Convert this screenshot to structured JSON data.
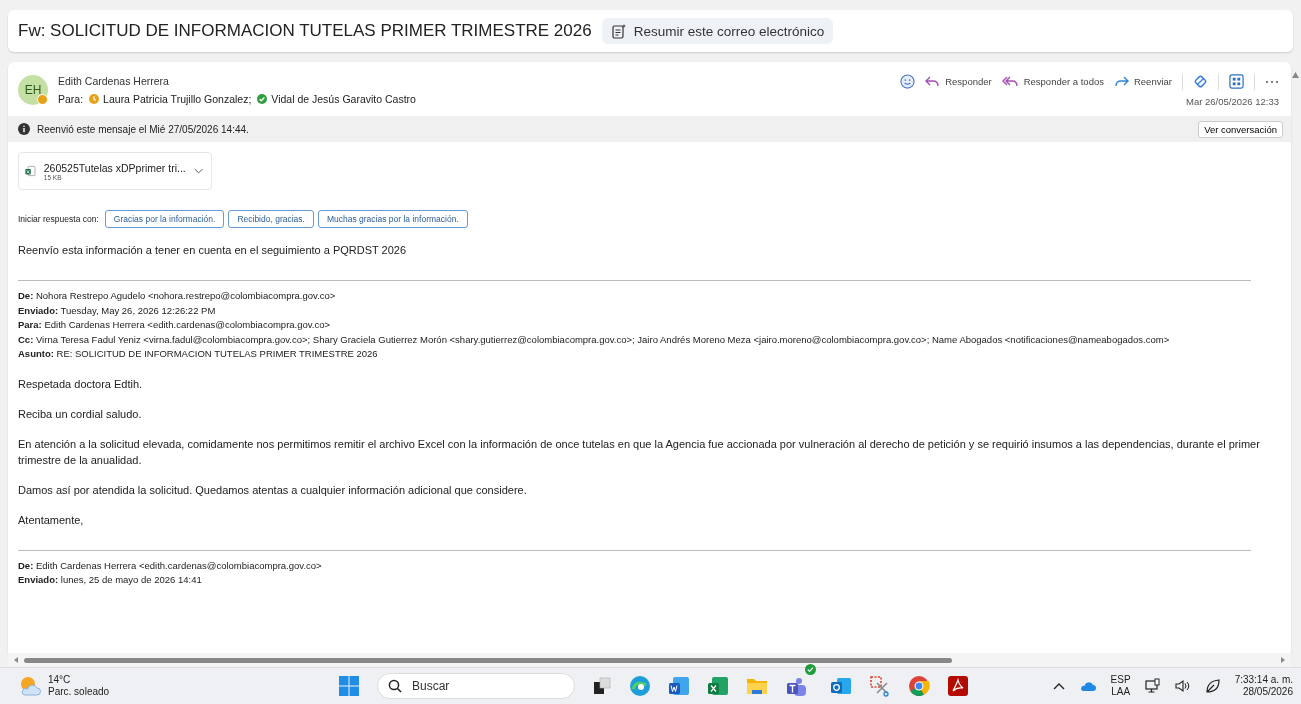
{
  "email_title": "Fw: SOLICITUD DE INFORMACION TUTELAS PRIMER TRIMESTRE 2026",
  "summarize_button": "Resumir este correo electrónico",
  "message": {
    "sender": {
      "initials": "EH",
      "name": "Edith Cardenas Herrera",
      "available": false
    },
    "to_label": "Para:",
    "recipients": [
      {
        "name": "Laura Patricia Trujillo Gonzalez;",
        "available": false
      },
      {
        "name": "Vidal de Jesús Garavito Castro",
        "available": true
      }
    ],
    "actions": [
      {
        "label": "Responder",
        "kind": "reply"
      },
      {
        "label": "Responder a todos",
        "kind": "reply_all"
      },
      {
        "label": "Reenviar",
        "kind": "forward"
      }
    ],
    "date": "Mar 26/05/2026 12:33"
  },
  "forward_notice": "Reenvió este mensaje el Mié 27/05/2026 14:44.",
  "view_conversation_button": "Ver conversación",
  "attachment": {
    "name": "260525Tutelas xDPprimer tri...",
    "size": "15 KB"
  },
  "suggested_replies": {
    "label": "Iniciar respuesta con:",
    "options": [
      "Gracias por la información.",
      "Recibido, gracias.",
      "Muchas gracias por la información."
    ]
  },
  "body": [
    {
      "kind": "paragraph",
      "text": "Reenvío esta información a tener en cuenta en el seguimiento a PQRDST 2026"
    },
    {
      "kind": "divider"
    },
    {
      "kind": "header",
      "lines": [
        "**De:** Nohora Restrepo Agudelo <nohora.restrepo@colombiacompra.gov.co>",
        "**Enviado:** Tuesday, May 26, 2026 12:26:22 PM",
        "**Para:** Edith Cardenas Herrera <edith.cardenas@colombiacompra.gov.co>",
        "**Cc:** Virna Teresa Fadul Yeniz <virna.fadul@colombiacompra.gov.co>; Shary Graciela Gutierrez Morón <shary.gutierrez@colombiacompra.gov.co>; Jairo Andrés Moreno Meza <jairo.moreno@colombiacompra.gov.co>; Name Abogados <notificaciones@nameabogados.com>",
        "**Asunto:** RE: SOLICITUD DE INFORMACION TUTELAS PRIMER TRIMESTRE 2026"
      ]
    },
    {
      "kind": "paragraph",
      "text": "Respetada doctora Edtih."
    },
    {
      "kind": "paragraph",
      "text": "Reciba un cordial saludo."
    },
    {
      "kind": "paragraph",
      "text": "En atención a la solicitud elevada, comidamente nos permitimos remitir el archivo Excel con  la información de once tutelas en que la Agencia fue accionada por vulneración al derecho de petición y se requirió insumos a las dependencias, durante el primer trimestre de la anualidad."
    },
    {
      "kind": "paragraph",
      "text": "Damos así por atendida la solicitud. Quedamos atentas a cualquier información adicional que considere."
    },
    {
      "kind": "paragraph",
      "text": "Atentamente,"
    },
    {
      "kind": "divider"
    },
    {
      "kind": "header",
      "lines": [
        "**De:** Edith Cardenas Herrera <edith.cardenas@colombiacompra.gov.co>",
        "**Enviado:** lunes, 25 de mayo de 2026 14:41"
      ]
    }
  ],
  "taskbar": {
    "temperature": "14°C",
    "weather": "Parc. soleado",
    "search_label": "Buscar",
    "language": "ESP",
    "layout": "LAA",
    "time": "7:33:14 a. m.",
    "date": "28/05/2026"
  }
}
